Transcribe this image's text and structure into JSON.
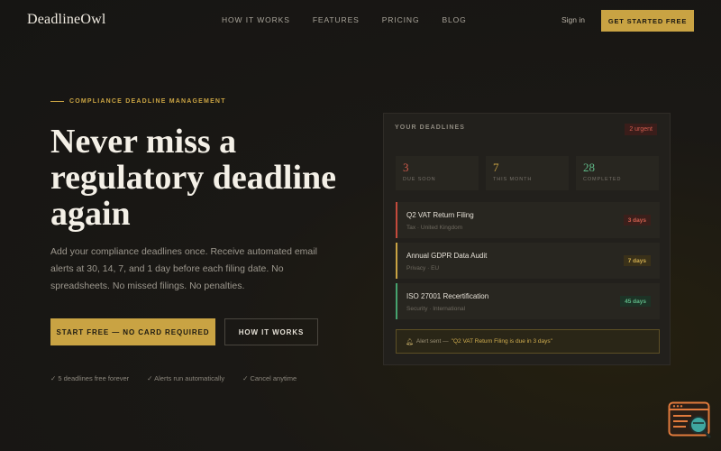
{
  "header": {
    "logo": "DeadlineOwl",
    "nav": [
      "HOW IT WORKS",
      "FEATURES",
      "PRICING",
      "BLOG"
    ],
    "signin": "Sign in",
    "cta": "GET STARTED FREE"
  },
  "hero": {
    "eyebrow": "COMPLIANCE DEADLINE MANAGEMENT",
    "headline": [
      "Never miss a",
      "regulatory deadline",
      "again"
    ],
    "lede": "Add your compliance deadlines once. Receive automated email alerts at 30, 14, 7, and 1 day before each filing date. No spreadsheets. No missed filings. No penalties.",
    "primary_button": "START FREE — NO CARD REQUIRED",
    "secondary_button": "HOW IT WORKS",
    "perks": [
      "✓ 5 deadlines free forever",
      "✓ Alerts run automatically",
      "✓ Cancel anytime"
    ]
  },
  "card": {
    "title": "YOUR DEADLINES",
    "urgent_badge": "2 urgent",
    "stats": [
      {
        "value": "3",
        "label": "DUE SOON",
        "color": "#d25a4b"
      },
      {
        "value": "7",
        "label": "THIS MONTH",
        "color": "#c9a343"
      },
      {
        "value": "28",
        "label": "COMPLETED",
        "color": "#5fb887"
      }
    ],
    "items": [
      {
        "title": "Q2 VAT Return Filing",
        "subtitle": "Tax · United Kingdom",
        "badge": "3 days",
        "accent": "#c44a3c",
        "badge_bg": "#3b1f1b",
        "badge_fg": "#d0604f"
      },
      {
        "title": "Annual GDPR Data Audit",
        "subtitle": "Privacy · EU",
        "badge": "7 days",
        "accent": "#c9a343",
        "badge_bg": "#3a3119",
        "badge_fg": "#d0ad4f"
      },
      {
        "title": "ISO 27001 Recertification",
        "subtitle": "Security · International",
        "badge": "45 days",
        "accent": "#46a36f",
        "badge_bg": "#1d3326",
        "badge_fg": "#5fb887"
      }
    ],
    "alert_prefix": "Alert sent —",
    "alert_message": "\"Q2 VAT Return Filing is due in 3 days\""
  },
  "icons": {
    "bell": "bell-icon",
    "corner": "browser-search-icon"
  }
}
